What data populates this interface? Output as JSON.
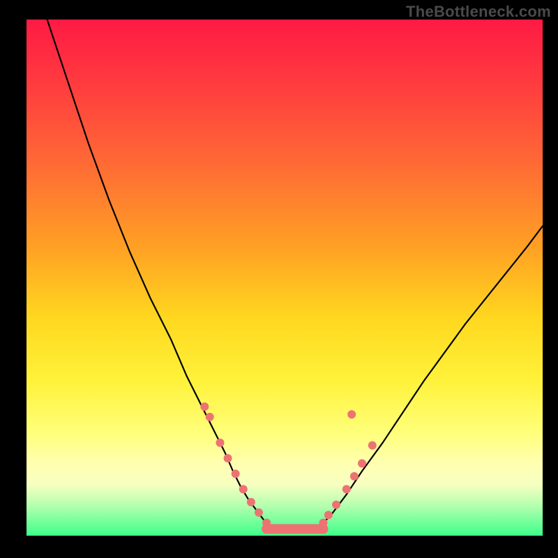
{
  "watermark": "TheBottleneck.com",
  "chart_data": {
    "type": "line",
    "title": "",
    "xlabel": "",
    "ylabel": "",
    "xlim": [
      0,
      100
    ],
    "ylim": [
      0,
      100
    ],
    "grid": false,
    "legend": false,
    "background_gradient": {
      "orientation": "vertical",
      "stops": [
        {
          "pct": 0,
          "color": "#ff1a44"
        },
        {
          "pct": 12,
          "color": "#ff3a3f"
        },
        {
          "pct": 28,
          "color": "#ff6a35"
        },
        {
          "pct": 44,
          "color": "#ffa024"
        },
        {
          "pct": 58,
          "color": "#ffd81f"
        },
        {
          "pct": 70,
          "color": "#fff23a"
        },
        {
          "pct": 80,
          "color": "#ffff7a"
        },
        {
          "pct": 86,
          "color": "#ffffb0"
        },
        {
          "pct": 90,
          "color": "#f7ffc0"
        },
        {
          "pct": 94,
          "color": "#b8ffb0"
        },
        {
          "pct": 100,
          "color": "#3dff8a"
        }
      ]
    },
    "series": [
      {
        "name": "left-curve",
        "color": "#000000",
        "x": [
          4,
          8,
          12,
          16,
          20,
          24,
          28,
          31,
          34,
          36.5,
          38.5,
          40,
          41.5,
          43,
          44.5,
          46,
          47.5
        ],
        "y": [
          100,
          88,
          76,
          65,
          55,
          46,
          38,
          31,
          25,
          20,
          16,
          12.5,
          9.5,
          7,
          5,
          3,
          1.5
        ]
      },
      {
        "name": "trough-line",
        "color": "#000000",
        "x": [
          47.5,
          56.5
        ],
        "y": [
          1.2,
          1.2
        ]
      },
      {
        "name": "right-curve",
        "color": "#000000",
        "x": [
          56.5,
          59,
          62,
          65,
          69,
          73,
          77,
          81,
          85,
          89,
          93,
          97,
          100
        ],
        "y": [
          1.5,
          4,
          8,
          12.5,
          18,
          24,
          30,
          35.5,
          41,
          46,
          51,
          56,
          60
        ]
      }
    ],
    "highlight_points": {
      "name": "marker-dots",
      "color": "#ed7373",
      "radius": 6,
      "points": [
        {
          "x": 34.5,
          "y": 25
        },
        {
          "x": 35.5,
          "y": 23
        },
        {
          "x": 37.5,
          "y": 18
        },
        {
          "x": 39.0,
          "y": 15
        },
        {
          "x": 40.5,
          "y": 12
        },
        {
          "x": 42.0,
          "y": 9
        },
        {
          "x": 43.5,
          "y": 6.5
        },
        {
          "x": 45.0,
          "y": 4.5
        },
        {
          "x": 46.5,
          "y": 2.5
        },
        {
          "x": 57.5,
          "y": 2.5
        },
        {
          "x": 58.5,
          "y": 4.0
        },
        {
          "x": 60.0,
          "y": 6.0
        },
        {
          "x": 62.0,
          "y": 9.0
        },
        {
          "x": 63.5,
          "y": 11.5
        },
        {
          "x": 65.0,
          "y": 14.0
        },
        {
          "x": 67.0,
          "y": 17.5
        },
        {
          "x": 63.0,
          "y": 23.5
        }
      ]
    },
    "trough_bar": {
      "name": "trough-bar",
      "color": "#ed7373",
      "x_start": 46.5,
      "x_end": 57.5,
      "y": 1.3,
      "thickness": 3.2
    }
  }
}
